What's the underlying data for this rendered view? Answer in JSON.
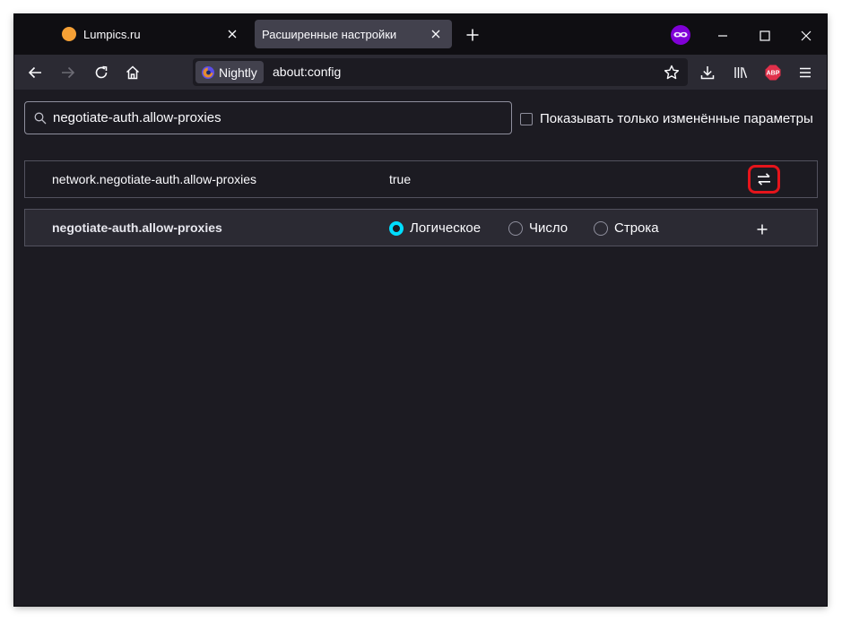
{
  "tabs": [
    {
      "title": "Lumpics.ru",
      "favicon": "orange-dot-icon",
      "favicon_color": "#f5a035",
      "active": false
    },
    {
      "title": "Расширенные настройки",
      "active": true
    }
  ],
  "toolbar": {
    "new_tab": "plus-icon",
    "identity_label": "Nightly",
    "url": "about:config",
    "abp_badge": "ABP"
  },
  "search": {
    "value": "negotiate-auth.allow-proxies",
    "placeholder": ""
  },
  "filter": {
    "label": "Показывать только изменённые параметры",
    "checked": false
  },
  "prefs": [
    {
      "name": "network.negotiate-auth.allow-proxies",
      "value": "true"
    }
  ],
  "new_pref": {
    "name": "negotiate-auth.allow-proxies",
    "types": [
      "Логическое",
      "Число",
      "Строка"
    ],
    "selected_type": "Логическое"
  },
  "colors": {
    "accent": "#00ddff",
    "highlight": "#e5141b",
    "private_badge": "#8000d7",
    "abp": "#e0304a"
  }
}
